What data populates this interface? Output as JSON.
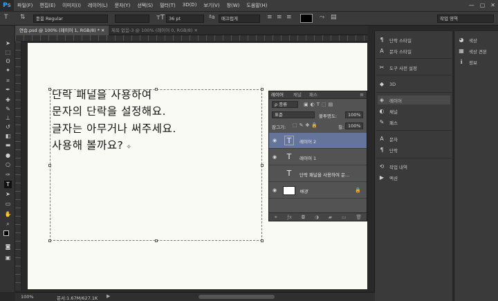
{
  "app": {
    "logo": "Ps"
  },
  "menu": [
    "파일(F)",
    "편집(E)",
    "이미지(I)",
    "레이어(L)",
    "문자(Y)",
    "선택(S)",
    "필터(T)",
    "3D(D)",
    "보기(V)",
    "창(W)",
    "도움말(H)"
  ],
  "window_controls": [
    "—",
    "▢",
    "✕"
  ],
  "options_bar": {
    "font_family": "돋움",
    "font_style": "Regular",
    "font_size": "36 pt",
    "antialias": "매끄럽게",
    "workspace": "작업 영역"
  },
  "tabs": [
    {
      "label": "연습.psd @ 100% (레이어 1, RGB/8) * ✕",
      "active": true
    },
    {
      "label": "제목 없음-3 @ 100% (레이어 0, RGB/8) ✕",
      "active": false
    }
  ],
  "canvas": {
    "lines": [
      "단락 패널을 사용하여",
      "문자의 단락을 설정해요.",
      "글자는 아무거나 써주세요.",
      "사용해 볼까요?"
    ],
    "cursor_glyph": "✧"
  },
  "layers_panel": {
    "tabs": [
      "레이어",
      "채널",
      "패스"
    ],
    "filter_label": "ρ 종류",
    "blend_mode": "표준",
    "opacity_label": "불투명도:",
    "opacity_value": "100%",
    "lock_label": "잠그기:",
    "fill_label": "칠:",
    "fill_value": "100%",
    "layers": [
      {
        "name": "레이어 2",
        "type": "text",
        "visible": true,
        "active": true
      },
      {
        "name": "레이어 1",
        "type": "text",
        "visible": true,
        "active": false
      },
      {
        "name": "단락 패널을 사용하여 문...",
        "type": "text",
        "visible": false,
        "active": false
      },
      {
        "name": "배경",
        "type": "background",
        "visible": true,
        "active": false
      }
    ],
    "bottom_icons": [
      "link-icon",
      "fx-icon",
      "mask-icon",
      "adjustment-icon",
      "folder-icon",
      "new-layer-icon",
      "trash-icon"
    ]
  },
  "dock_mid": [
    {
      "icon": "¶",
      "label": "단락 스타일",
      "name": "dock-paragraph-style"
    },
    {
      "icon": "A",
      "label": "문자 스타일",
      "name": "dock-character-style"
    },
    {
      "icon": "✂",
      "label": "도구 사전 설정",
      "name": "dock-tool-presets"
    },
    {
      "icon": "◆",
      "label": "3D",
      "name": "dock-3d"
    },
    {
      "icon": "◈",
      "label": "레이어",
      "name": "dock-layers"
    },
    {
      "icon": "◐",
      "label": "채널",
      "name": "dock-channels"
    },
    {
      "icon": "✎",
      "label": "패스",
      "name": "dock-paths"
    },
    {
      "icon": "A",
      "label": "문자",
      "name": "dock-character"
    },
    {
      "icon": "¶",
      "label": "단락",
      "name": "dock-paragraph"
    },
    {
      "icon": "⟲",
      "label": "작업 내역",
      "name": "dock-history"
    },
    {
      "icon": "▶",
      "label": "액션",
      "name": "dock-actions"
    }
  ],
  "dock_right": [
    {
      "icon": "◕",
      "label": "색상",
      "name": "dock-color"
    },
    {
      "icon": "▦",
      "label": "색상 견본",
      "name": "dock-swatches"
    },
    {
      "icon": "ℹ",
      "label": "정보",
      "name": "dock-info"
    }
  ],
  "status": {
    "zoom": "100%",
    "doc": "문서:1.67M/627.1K"
  }
}
